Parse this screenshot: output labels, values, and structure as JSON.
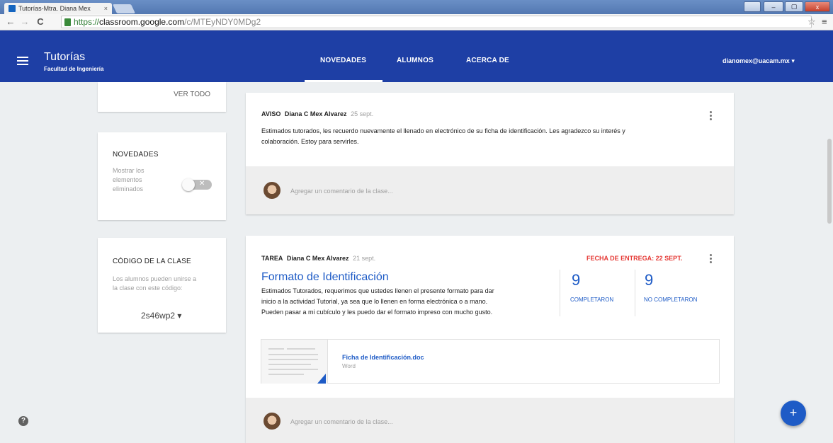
{
  "browser": {
    "tab_title": "Tutorías-Mtra. Diana Mex",
    "tab_close": "×",
    "url_secure": "https://",
    "url_host": "classroom.google.com",
    "url_path": "/c/MTEyNDY0MDg2",
    "back_icon": "←",
    "forward_icon": "→",
    "reload_icon": "C",
    "star_icon": "☆",
    "menu_icon": "≡",
    "window_controls": {
      "minimize": "–",
      "maximize": "▢",
      "close": "x"
    }
  },
  "header": {
    "class_name": "Tutorías",
    "class_section": "Facultad de Ingeniería",
    "tabs": [
      {
        "label": "NOVEDADES",
        "active": true
      },
      {
        "label": "ALUMNOS",
        "active": false
      },
      {
        "label": "ACERCA DE",
        "active": false
      }
    ],
    "user_email": "dianomex@uacam.mx ▾"
  },
  "sidebar": {
    "upcoming_view_all": "VER TODO",
    "stream_heading": "NOVEDADES",
    "show_deleted_label": "Mostrar los elementos eliminados",
    "show_deleted_line1": "Mostrar los",
    "show_deleted_line2": "elementos",
    "show_deleted_line3": "eliminados",
    "show_deleted_value": false,
    "class_code_heading": "CÓDIGO DE LA CLASE",
    "class_code_desc_line1": "Los alumnos pueden unirse a",
    "class_code_desc_line2": "la clase con este código:",
    "class_code": "2s46wp2 ▾"
  },
  "posts": [
    {
      "type": "AVISO",
      "author": "Diana C Mex Alvarez",
      "date": "25 sept.",
      "body_line1": "Estimados tutorados, les recuerdo nuevamente el llenado en electrónico de su ficha de identificación. Les agradezco su interés y",
      "body_line2": "colaboración. Estoy para servirles.",
      "comment_placeholder": "Agregar un comentario de la clase..."
    },
    {
      "type": "TAREA",
      "author": "Diana C Mex Alvarez",
      "date": "21 sept.",
      "due_label": "FECHA DE ENTREGA: 22 SEPT.",
      "title": "Formato de Identificación",
      "body_line1": "Estimados Tutorados, requerimos que ustedes llenen el presente formato para dar",
      "body_line2": "inicio a la actividad Tutorial, ya sea que lo llenen en forma electrónica o a mano.",
      "body_line3": "Pueden pasar a mi cubículo y les puedo dar el formato impreso con mucho gusto.",
      "completed_count": "9",
      "completed_label": "COMPLETARON",
      "not_completed_count": "9",
      "not_completed_label": "NO COMPLETARON",
      "attachment_name": "Ficha de Identificación.doc",
      "attachment_type": "Word",
      "comment_placeholder": "Agregar un comentario de la clase..."
    }
  ],
  "fab_icon": "+",
  "help_icon": "?"
}
